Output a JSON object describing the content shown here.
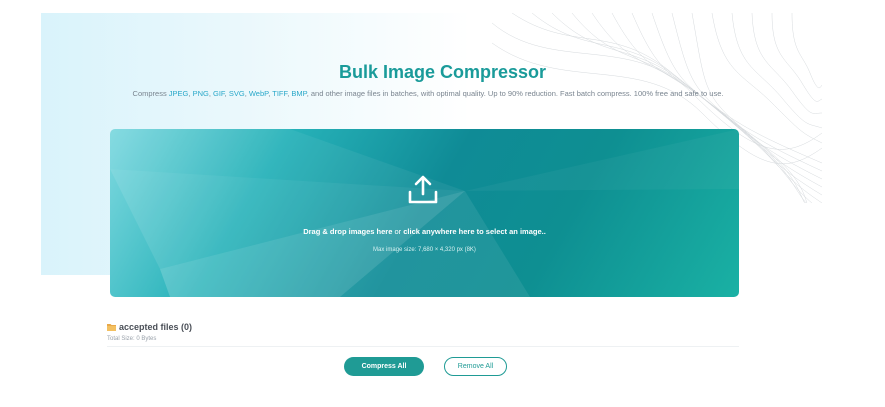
{
  "header": {
    "title": "Bulk Image Compressor",
    "subtitle_prefix": "Compress ",
    "formats": [
      {
        "text": "JPEG",
        "sep": ", "
      },
      {
        "text": "PNG",
        "sep": ", "
      },
      {
        "text": "GIF",
        "sep": ", "
      },
      {
        "text": "SVG",
        "sep": ", "
      },
      {
        "text": "WebP",
        "sep": ", "
      },
      {
        "text": "TIFF",
        "sep": ", "
      },
      {
        "text": "BMP",
        "sep": ""
      }
    ],
    "subtitle_suffix": ", and other image files in batches, with optimal quality. Up to 90% reduction. Fast batch compress. 100% free and safe to use."
  },
  "dropzone": {
    "text_main": "Drag & drop images here",
    "text_or": " or ",
    "text_click": "click anywhere here to select an image..",
    "max_size": "Max image size: 7,680 × 4,320 px (8K)",
    "icon": "upload-icon"
  },
  "files": {
    "accepted_label": "accepted files (0)",
    "total_size": "Total Size: 0 Bytes",
    "icon": "folder-icon"
  },
  "actions": {
    "compress_all": "Compress All",
    "remove_all": "Remove All"
  },
  "colors": {
    "accent": "#1f9b95",
    "title": "#1a9b9a",
    "format_link": "#2aa8c9"
  }
}
